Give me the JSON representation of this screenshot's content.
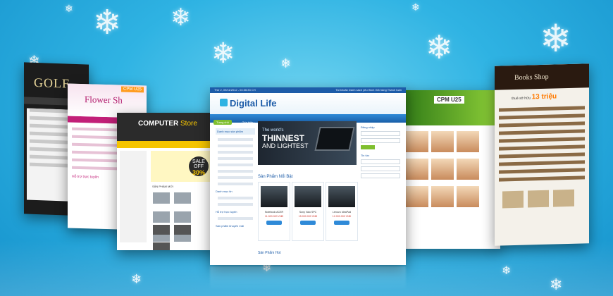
{
  "scene": {
    "background": "#2fb3e3",
    "accent": "#1d5ca8",
    "snowflake_icon": "snowflake-icon"
  },
  "panels": {
    "golf": {
      "brand": "GOLF"
    },
    "flower": {
      "brand": "Flower Sh",
      "cpm": "CPM U25",
      "label": "Hỗ trợ trực tuyến"
    },
    "computer": {
      "brand_main": "COMPUTER",
      "brand_sub": "Store",
      "sale_top": "SALE OFF",
      "sale_value": "30%",
      "section": "SẢN PHẨM MỚI"
    },
    "digital": {
      "topbar_left": "Thứ 2, 09/11/2012 - 04:36:33 CH",
      "topbar_right": "Tài khoản  Danh sách yêu thích  Giỏ hàng  Thanh toán",
      "brand": "Digital Life",
      "nav": [
        "Trang chủ",
        "Giới thiệu",
        "Sản phẩm",
        "Tin tức",
        "Liên hệ"
      ],
      "left_header": "Danh mục sản phẩm",
      "left_t1": "Danh mục tin",
      "left_t2": "Hỗ trợ trực tuyến",
      "left_t3": "Sản phẩm khuyến mãi",
      "banner_line1": "The world's",
      "banner_line2": "THINNEST",
      "banner_line3": "AND LIGHTEST",
      "section": "Sản Phẩm Nổi Bật",
      "products": [
        {
          "name": "Notebook ACER",
          "price": "11.000.000 VNĐ"
        },
        {
          "name": "Sony Vaio SPC",
          "price": "15.000.000 VNĐ"
        },
        {
          "name": "Lenovo IdeaPad",
          "price": "12.000.000 VNĐ"
        }
      ],
      "right_h1": "Đăng nhập",
      "right_h2": "Tin tức",
      "bottom_section": "Sản Phẩm Hot"
    },
    "green": {
      "cpm": "CPM U25"
    },
    "books": {
      "brand": "Books Shop",
      "promo_text": "thuê sở hữu",
      "promo_value": "13 triệu"
    }
  }
}
